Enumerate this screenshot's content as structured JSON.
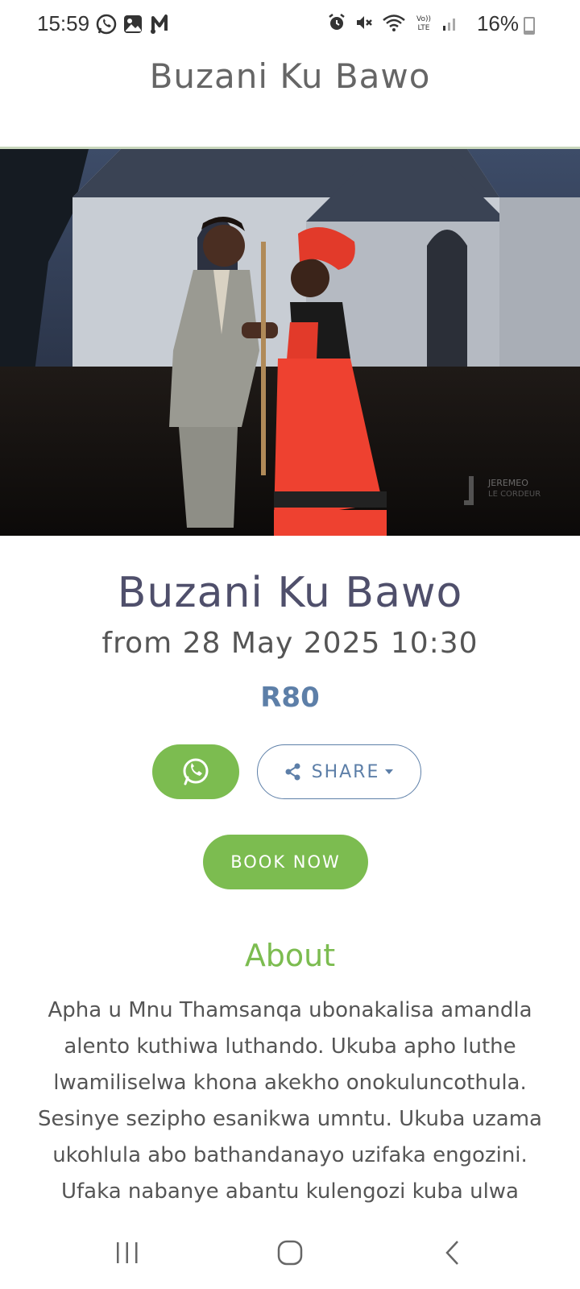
{
  "status_bar": {
    "time": "15:59",
    "battery_text": "16%",
    "left_icons": [
      "whatsapp-icon",
      "gallery-icon",
      "music-icon"
    ],
    "right_icons": [
      "alarm-icon",
      "mute-icon",
      "wifi-icon",
      "volte-icon",
      "signal-icon",
      "battery-icon"
    ],
    "battery_level": 0.16
  },
  "header": {
    "title": "Buzani Ku Bawo"
  },
  "hero": {
    "watermark": "JEREMEO LE CORDEUR"
  },
  "event": {
    "title": "Buzani Ku Bawo",
    "date": "from 28 May 2025 10:30",
    "price": "R80"
  },
  "actions": {
    "share_label": "SHARE",
    "book_label": "BOOK NOW"
  },
  "about": {
    "heading": "About",
    "text": "Apha u Mnu Thamsanqa ubonakalisa amandla alento kuthiwa luthando. Ukuba apho luthe lwamiliselwa khona akekho onokuluncothula. Sesinye sezipho esanikwa umntu. Ukuba uzama ukohlula abo bathandanayo uzifaka engozini. Ufaka nabanye abantu kulengozi kuba ulwa"
  },
  "colors": {
    "accent_green": "#7cbc50",
    "accent_blue": "#5d7fa8",
    "title": "#4f4f6b"
  }
}
